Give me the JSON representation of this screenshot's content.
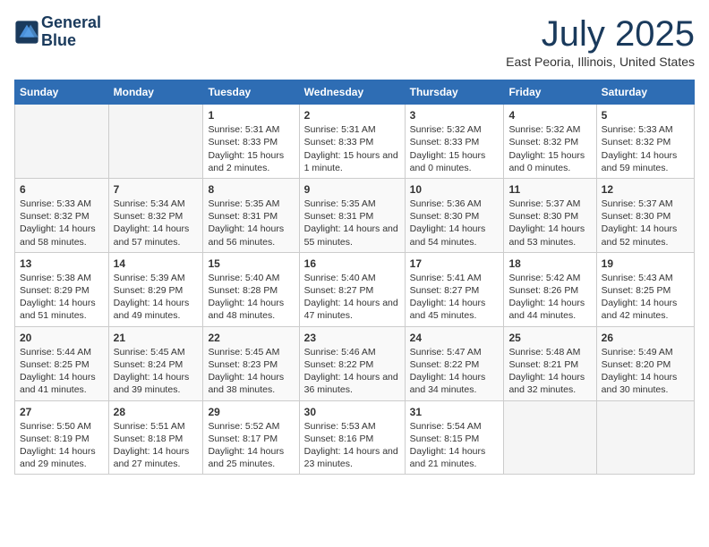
{
  "header": {
    "logo_line1": "General",
    "logo_line2": "Blue",
    "month": "July 2025",
    "location": "East Peoria, Illinois, United States"
  },
  "days_of_week": [
    "Sunday",
    "Monday",
    "Tuesday",
    "Wednesday",
    "Thursday",
    "Friday",
    "Saturday"
  ],
  "weeks": [
    [
      {
        "day": "",
        "empty": true
      },
      {
        "day": "",
        "empty": true
      },
      {
        "day": "1",
        "sunrise": "5:31 AM",
        "sunset": "8:33 PM",
        "daylight": "15 hours and 2 minutes."
      },
      {
        "day": "2",
        "sunrise": "5:31 AM",
        "sunset": "8:33 PM",
        "daylight": "15 hours and 1 minute."
      },
      {
        "day": "3",
        "sunrise": "5:32 AM",
        "sunset": "8:33 PM",
        "daylight": "15 hours and 0 minutes."
      },
      {
        "day": "4",
        "sunrise": "5:32 AM",
        "sunset": "8:32 PM",
        "daylight": "15 hours and 0 minutes."
      },
      {
        "day": "5",
        "sunrise": "5:33 AM",
        "sunset": "8:32 PM",
        "daylight": "14 hours and 59 minutes."
      }
    ],
    [
      {
        "day": "6",
        "sunrise": "5:33 AM",
        "sunset": "8:32 PM",
        "daylight": "14 hours and 58 minutes."
      },
      {
        "day": "7",
        "sunrise": "5:34 AM",
        "sunset": "8:32 PM",
        "daylight": "14 hours and 57 minutes."
      },
      {
        "day": "8",
        "sunrise": "5:35 AM",
        "sunset": "8:31 PM",
        "daylight": "14 hours and 56 minutes."
      },
      {
        "day": "9",
        "sunrise": "5:35 AM",
        "sunset": "8:31 PM",
        "daylight": "14 hours and 55 minutes."
      },
      {
        "day": "10",
        "sunrise": "5:36 AM",
        "sunset": "8:30 PM",
        "daylight": "14 hours and 54 minutes."
      },
      {
        "day": "11",
        "sunrise": "5:37 AM",
        "sunset": "8:30 PM",
        "daylight": "14 hours and 53 minutes."
      },
      {
        "day": "12",
        "sunrise": "5:37 AM",
        "sunset": "8:30 PM",
        "daylight": "14 hours and 52 minutes."
      }
    ],
    [
      {
        "day": "13",
        "sunrise": "5:38 AM",
        "sunset": "8:29 PM",
        "daylight": "14 hours and 51 minutes."
      },
      {
        "day": "14",
        "sunrise": "5:39 AM",
        "sunset": "8:29 PM",
        "daylight": "14 hours and 49 minutes."
      },
      {
        "day": "15",
        "sunrise": "5:40 AM",
        "sunset": "8:28 PM",
        "daylight": "14 hours and 48 minutes."
      },
      {
        "day": "16",
        "sunrise": "5:40 AM",
        "sunset": "8:27 PM",
        "daylight": "14 hours and 47 minutes."
      },
      {
        "day": "17",
        "sunrise": "5:41 AM",
        "sunset": "8:27 PM",
        "daylight": "14 hours and 45 minutes."
      },
      {
        "day": "18",
        "sunrise": "5:42 AM",
        "sunset": "8:26 PM",
        "daylight": "14 hours and 44 minutes."
      },
      {
        "day": "19",
        "sunrise": "5:43 AM",
        "sunset": "8:25 PM",
        "daylight": "14 hours and 42 minutes."
      }
    ],
    [
      {
        "day": "20",
        "sunrise": "5:44 AM",
        "sunset": "8:25 PM",
        "daylight": "14 hours and 41 minutes."
      },
      {
        "day": "21",
        "sunrise": "5:45 AM",
        "sunset": "8:24 PM",
        "daylight": "14 hours and 39 minutes."
      },
      {
        "day": "22",
        "sunrise": "5:45 AM",
        "sunset": "8:23 PM",
        "daylight": "14 hours and 38 minutes."
      },
      {
        "day": "23",
        "sunrise": "5:46 AM",
        "sunset": "8:22 PM",
        "daylight": "14 hours and 36 minutes."
      },
      {
        "day": "24",
        "sunrise": "5:47 AM",
        "sunset": "8:22 PM",
        "daylight": "14 hours and 34 minutes."
      },
      {
        "day": "25",
        "sunrise": "5:48 AM",
        "sunset": "8:21 PM",
        "daylight": "14 hours and 32 minutes."
      },
      {
        "day": "26",
        "sunrise": "5:49 AM",
        "sunset": "8:20 PM",
        "daylight": "14 hours and 30 minutes."
      }
    ],
    [
      {
        "day": "27",
        "sunrise": "5:50 AM",
        "sunset": "8:19 PM",
        "daylight": "14 hours and 29 minutes."
      },
      {
        "day": "28",
        "sunrise": "5:51 AM",
        "sunset": "8:18 PM",
        "daylight": "14 hours and 27 minutes."
      },
      {
        "day": "29",
        "sunrise": "5:52 AM",
        "sunset": "8:17 PM",
        "daylight": "14 hours and 25 minutes."
      },
      {
        "day": "30",
        "sunrise": "5:53 AM",
        "sunset": "8:16 PM",
        "daylight": "14 hours and 23 minutes."
      },
      {
        "day": "31",
        "sunrise": "5:54 AM",
        "sunset": "8:15 PM",
        "daylight": "14 hours and 21 minutes."
      },
      {
        "day": "",
        "empty": true
      },
      {
        "day": "",
        "empty": true
      }
    ]
  ]
}
